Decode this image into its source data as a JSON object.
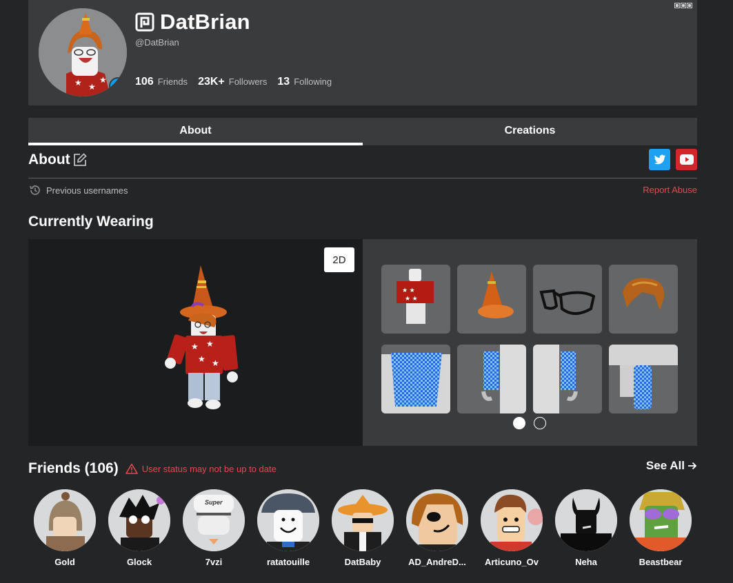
{
  "profile": {
    "display_name": "DatBrian",
    "username": "@DatBrian",
    "premium_icon": "premium-icon",
    "presence_icon": "user-icon",
    "stats": [
      {
        "value": "106",
        "label": "Friends"
      },
      {
        "value": "23K+",
        "label": "Followers"
      },
      {
        "value": "13",
        "label": "Following"
      }
    ],
    "more_icon": "more-options-icon"
  },
  "tabs": [
    {
      "label": "About",
      "active": true
    },
    {
      "label": "Creations",
      "active": false
    }
  ],
  "about": {
    "title": "About",
    "edit_icon": "edit-icon",
    "social": [
      {
        "name": "twitter",
        "icon": "twitter-icon",
        "color": "#1da1f2"
      },
      {
        "name": "youtube",
        "icon": "youtube-icon",
        "color": "#d3262a"
      }
    ],
    "previous_usernames": "Previous usernames",
    "report_abuse": "Report Abuse"
  },
  "currently_wearing": {
    "title": "Currently Wearing",
    "toggle_label": "2D",
    "items": [
      {
        "name": "red-star-shirt"
      },
      {
        "name": "traffic-cone-hat"
      },
      {
        "name": "black-glasses"
      },
      {
        "name": "orange-hair"
      },
      {
        "name": "blue-checkered-torso"
      },
      {
        "name": "blue-checkered-right-arm"
      },
      {
        "name": "blue-checkered-left-arm"
      },
      {
        "name": "blue-checkered-leg"
      }
    ],
    "pages": 2,
    "current_page": 1
  },
  "friends": {
    "title": "Friends (106)",
    "warning": "User status may not be up to date",
    "see_all": "See All",
    "list": [
      {
        "name": "Gold"
      },
      {
        "name": "Glock"
      },
      {
        "name": "7vzi"
      },
      {
        "name": "ratatouille"
      },
      {
        "name": "DatBaby"
      },
      {
        "name": "AD_AndreD..."
      },
      {
        "name": "Articuno_Ov"
      },
      {
        "name": "Neha"
      },
      {
        "name": "Beastbear"
      }
    ]
  },
  "colors": {
    "background": "#232527",
    "card": "#393b3d",
    "accent_blue": "#00a2ff",
    "alert_red": "#e54a4f"
  }
}
